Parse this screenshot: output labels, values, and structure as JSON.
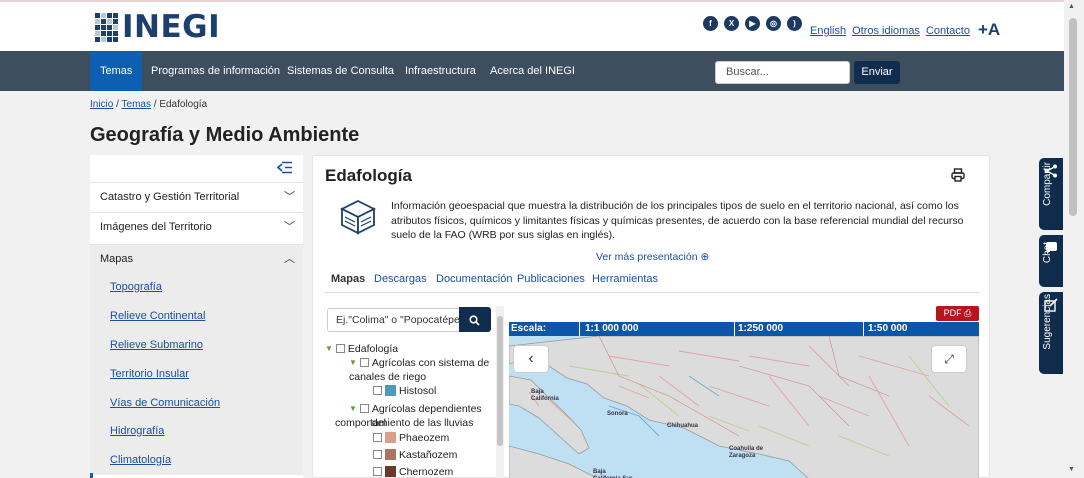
{
  "header": {
    "logo_text": "INEGI",
    "social_icons": [
      "facebook-icon",
      "x-icon",
      "youtube-icon",
      "instagram-icon",
      "rss-icon"
    ],
    "links": [
      "English",
      "Otros idiomas",
      "Contacto"
    ],
    "text_size": "+A"
  },
  "nav": {
    "tabs": [
      "Temas",
      "Programas de información",
      "Sistemas de Consulta",
      "Infraestructura",
      "Acerca del INEGI"
    ],
    "search_placeholder": "Buscar...",
    "search_button": "Enviar"
  },
  "breadcrumb": {
    "items": [
      "Inicio",
      "Temas"
    ],
    "current": "Edafología",
    "separator": "/"
  },
  "page_title": "Geografía y Medio Ambiente",
  "sidebar": {
    "sections": [
      "Catastro y Gestión Territorial",
      "Imágenes del Territorio",
      "Mapas"
    ],
    "subitems": [
      "Topografía",
      "Relieve Continental",
      "Relieve Submarino",
      "Territorio Insular",
      "Vías de Comunicación",
      "Hidrografía",
      "Climatología"
    ]
  },
  "main": {
    "title": "Edafología",
    "description": "Información geoespacial que muestra la distribución de los principales tipos de suelo en el territorio nacional, así como los atributos físicos, químicos y limitantes físicas y químicas presentes, de acuerdo con la base referencial mundial del recurso suelo de la FAO (WRB por sus siglas en inglés).",
    "more_link": "Ver más presentación",
    "tabs": [
      "Mapas",
      "Descargas",
      "Documentación",
      "Publicaciones",
      "Herramientas"
    ]
  },
  "tree": {
    "search_placeholder": "Ej.\"Colima\" o \"Popocatépetl\"",
    "root": "Edafología",
    "group1": [
      "Agrícolas con sistema de",
      "canales de riego"
    ],
    "group1_items": [
      {
        "label": "Histosol",
        "color": "#4a9ab8"
      }
    ],
    "group2": [
      "Agrícolas dependientes del",
      "comportamiento de las lluvias"
    ],
    "group2_items": [
      {
        "label": "Phaeozem",
        "color": "#d8a08a"
      },
      {
        "label": "Kastañozem",
        "color": "#a87560"
      },
      {
        "label": "Chernozem",
        "color": "#6b3a2a"
      }
    ]
  },
  "map": {
    "pdf_label": "PDF",
    "scale_label": "Escala:",
    "scales": [
      "1:1 000 000",
      "1:250 000",
      "1:50 000"
    ],
    "place_labels": [
      "Baja California",
      "Sonora",
      "Chihuahua",
      "Coahuila de Zaragoza",
      "Baja California Sur"
    ],
    "colors": {
      "sea": "#bfe0f3",
      "land": "#dcdcdc",
      "scalebar": "#0b56a8"
    }
  },
  "floating": {
    "share": "Compartir",
    "chat": "Chat",
    "suggestions": "Sugerencias"
  }
}
